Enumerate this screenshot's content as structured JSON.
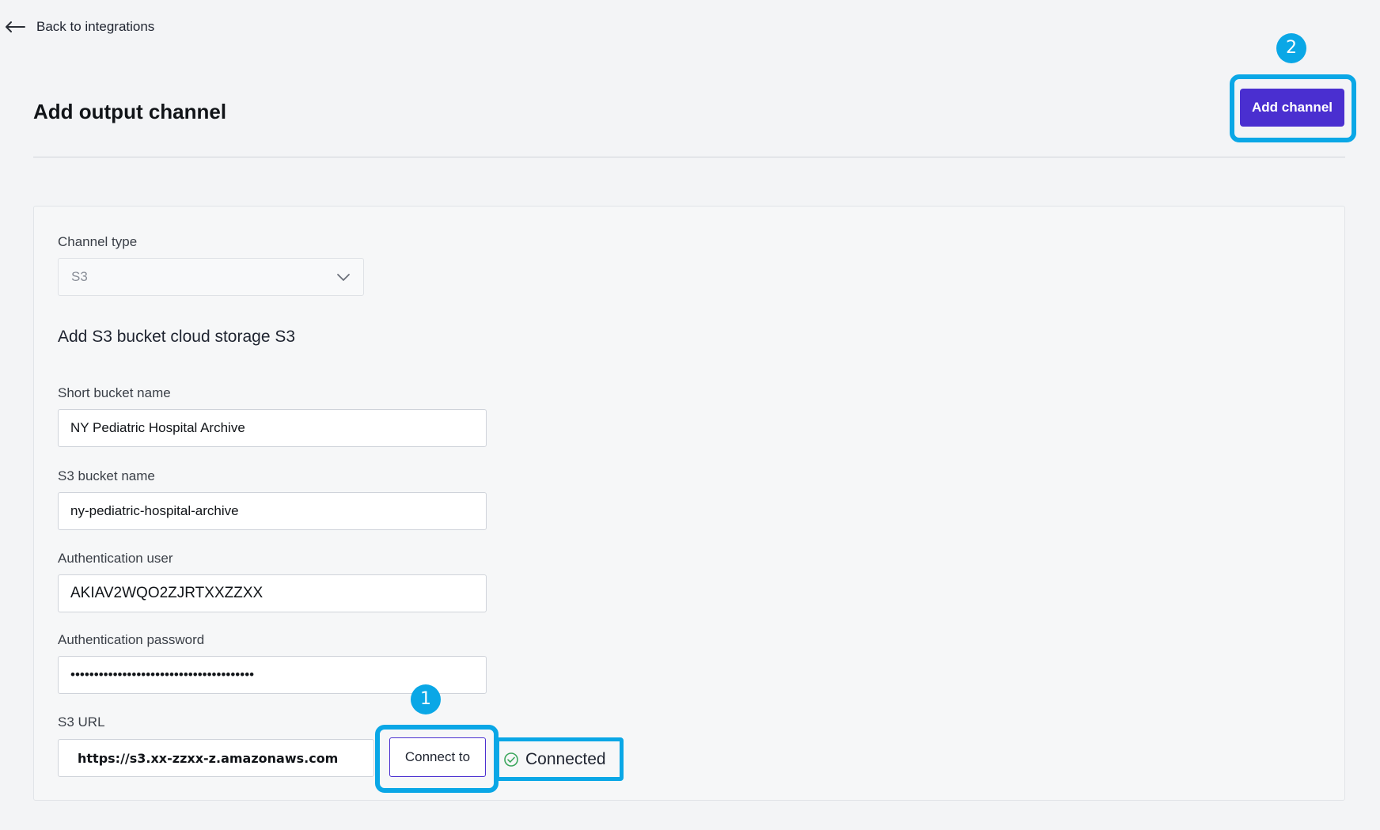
{
  "nav": {
    "back_label": "Back to integrations"
  },
  "page": {
    "title": "Add output channel"
  },
  "header": {
    "add_channel_label": "Add channel"
  },
  "callouts": {
    "first": "1",
    "second": "2"
  },
  "form": {
    "channel_type": {
      "label": "Channel type",
      "value": "S3"
    },
    "section_heading": "Add S3 bucket cloud storage S3",
    "short_bucket_name": {
      "label": "Short bucket name",
      "value": "NY Pediatric Hospital Archive"
    },
    "s3_bucket_name": {
      "label": "S3 bucket name",
      "value": "ny-pediatric-hospital-archive"
    },
    "auth_user": {
      "label": "Authentication user",
      "value": "AKIAV2WQO2ZJRTXXZZXX"
    },
    "auth_password": {
      "label": "Authentication password",
      "value": "•••••••••••••••••••••••••••••••••••••••"
    },
    "s3_url": {
      "label": "S3 URL",
      "value": "https://s3.xx-zzxx-z.amazonaws.com"
    },
    "connect_label": "Connect to",
    "status": {
      "text": "Connected",
      "color": "#3aa65c"
    }
  },
  "colors": {
    "accent": "#4a2fd0",
    "callout": "#0aa7e6"
  },
  "icons": {
    "back": "arrow-left-icon",
    "dropdown": "chevron-down-icon",
    "status": "check-circle-icon"
  }
}
